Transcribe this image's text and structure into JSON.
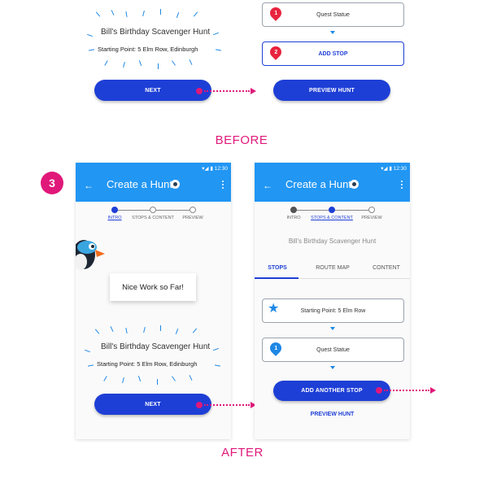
{
  "before": {
    "hunt_title": "Bill's Birthday Scavenger Hunt",
    "starting_point": "Starting Point: 5 Elm Row, Edinburgh",
    "next_label": "NEXT",
    "stop1_number": "1",
    "stop1_label": "Quest Statue",
    "stop2_number": "2",
    "stop2_label": "ADD STOP",
    "preview_label": "PREVIEW HUNT",
    "caption": "BEFORE"
  },
  "badge_number": "3",
  "after": {
    "status_time": "12:30",
    "appbar_title": "Create a Hunt",
    "steps": [
      "INTRO",
      "STOPS & CONTENT",
      "PREVIEW"
    ],
    "intro": {
      "speech": "Nice Work so Far!",
      "hunt_title": "Bill's Birthday Scavenger Hunt",
      "starting_point": "Starting Point: 5 Elm Row, Edinburgh",
      "next_label": "NEXT"
    },
    "stops": {
      "hunt_title": "Bill's Birthday Scavenger Hunt",
      "tabs": [
        "STOPS",
        "ROUTE MAP",
        "CONTENT"
      ],
      "start_label": "Starting Point: 5 Elm Row",
      "stop1_number": "1",
      "stop1_label": "Quest Statue",
      "add_another_label": "ADD ANOTHER STOP",
      "preview_label": "PREVIEW HUNT"
    },
    "caption": "AFTER"
  },
  "colors": {
    "accent_blue": "#1e3fd6",
    "app_bar": "#2196f3",
    "pink": "#e0187a",
    "pin_red": "#e8243e"
  }
}
